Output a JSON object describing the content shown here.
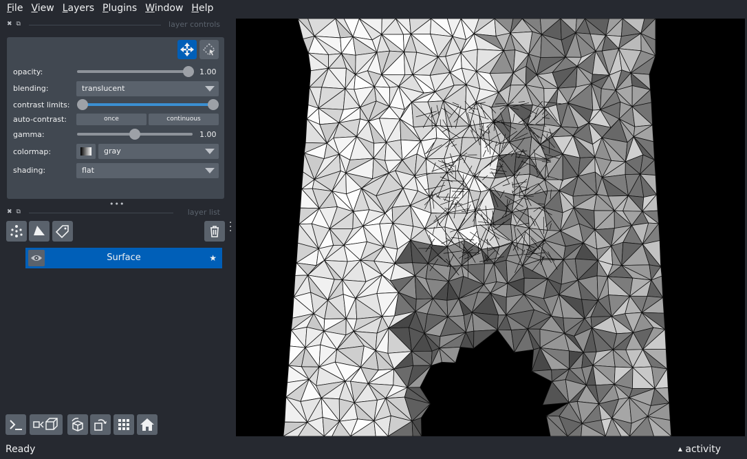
{
  "menu": {
    "file": {
      "u": "F",
      "rest": "ile"
    },
    "view": {
      "u": "V",
      "rest": "iew"
    },
    "layers": {
      "u": "L",
      "rest": "ayers"
    },
    "plugins": {
      "u": "P",
      "rest": "lugins"
    },
    "window": {
      "u": "W",
      "rest": "indow"
    },
    "help": {
      "u": "H",
      "rest": "elp"
    }
  },
  "layer_controls": {
    "title": "layer controls",
    "opacity_label": "opacity:",
    "opacity_value": "1.00",
    "opacity_level": 1.0,
    "blending_label": "blending:",
    "blending_value": "translucent",
    "contrast_label": "contrast limits:",
    "contrast_range": [
      0.0,
      1.0
    ],
    "autocontrast_label": "auto-contrast:",
    "once_label": "once",
    "continuous_label": "continuous",
    "gamma_label": "gamma:",
    "gamma_value": "1.00",
    "gamma_level": 0.5,
    "colormap_label": "colormap:",
    "colormap_value": "gray",
    "shading_label": "shading:",
    "shading_value": "flat"
  },
  "layer_list": {
    "title": "layer list",
    "layers": [
      {
        "name": "Surface",
        "visible": true,
        "selected": true
      }
    ]
  },
  "status": {
    "message": "Ready",
    "activity_label": "activity"
  },
  "colors": {
    "background": "#262930",
    "panel": "#414851",
    "control": "#5a626c",
    "accent": "#005fb8",
    "canvas": "#000000"
  }
}
